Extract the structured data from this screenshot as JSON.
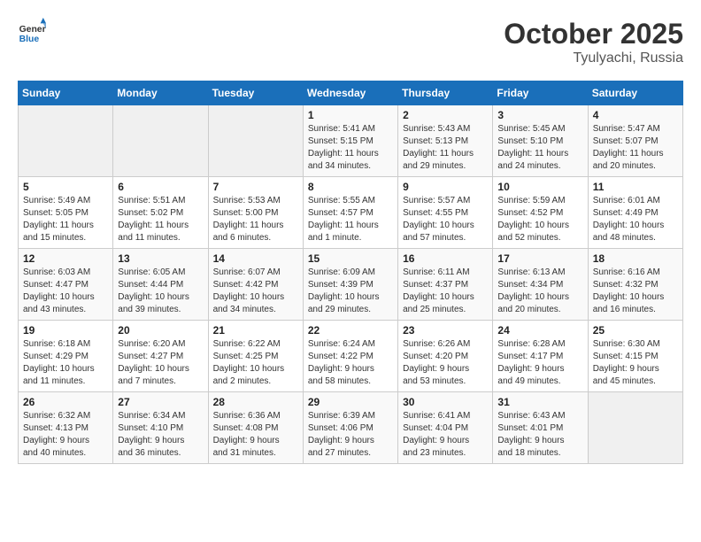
{
  "header": {
    "logo_line1": "General",
    "logo_line2": "Blue",
    "month": "October 2025",
    "location": "Tyulyachi, Russia"
  },
  "days_of_week": [
    "Sunday",
    "Monday",
    "Tuesday",
    "Wednesday",
    "Thursday",
    "Friday",
    "Saturday"
  ],
  "weeks": [
    [
      {
        "day": "",
        "info": ""
      },
      {
        "day": "",
        "info": ""
      },
      {
        "day": "",
        "info": ""
      },
      {
        "day": "1",
        "info": "Sunrise: 5:41 AM\nSunset: 5:15 PM\nDaylight: 11 hours\nand 34 minutes."
      },
      {
        "day": "2",
        "info": "Sunrise: 5:43 AM\nSunset: 5:13 PM\nDaylight: 11 hours\nand 29 minutes."
      },
      {
        "day": "3",
        "info": "Sunrise: 5:45 AM\nSunset: 5:10 PM\nDaylight: 11 hours\nand 24 minutes."
      },
      {
        "day": "4",
        "info": "Sunrise: 5:47 AM\nSunset: 5:07 PM\nDaylight: 11 hours\nand 20 minutes."
      }
    ],
    [
      {
        "day": "5",
        "info": "Sunrise: 5:49 AM\nSunset: 5:05 PM\nDaylight: 11 hours\nand 15 minutes."
      },
      {
        "day": "6",
        "info": "Sunrise: 5:51 AM\nSunset: 5:02 PM\nDaylight: 11 hours\nand 11 minutes."
      },
      {
        "day": "7",
        "info": "Sunrise: 5:53 AM\nSunset: 5:00 PM\nDaylight: 11 hours\nand 6 minutes."
      },
      {
        "day": "8",
        "info": "Sunrise: 5:55 AM\nSunset: 4:57 PM\nDaylight: 11 hours\nand 1 minute."
      },
      {
        "day": "9",
        "info": "Sunrise: 5:57 AM\nSunset: 4:55 PM\nDaylight: 10 hours\nand 57 minutes."
      },
      {
        "day": "10",
        "info": "Sunrise: 5:59 AM\nSunset: 4:52 PM\nDaylight: 10 hours\nand 52 minutes."
      },
      {
        "day": "11",
        "info": "Sunrise: 6:01 AM\nSunset: 4:49 PM\nDaylight: 10 hours\nand 48 minutes."
      }
    ],
    [
      {
        "day": "12",
        "info": "Sunrise: 6:03 AM\nSunset: 4:47 PM\nDaylight: 10 hours\nand 43 minutes."
      },
      {
        "day": "13",
        "info": "Sunrise: 6:05 AM\nSunset: 4:44 PM\nDaylight: 10 hours\nand 39 minutes."
      },
      {
        "day": "14",
        "info": "Sunrise: 6:07 AM\nSunset: 4:42 PM\nDaylight: 10 hours\nand 34 minutes."
      },
      {
        "day": "15",
        "info": "Sunrise: 6:09 AM\nSunset: 4:39 PM\nDaylight: 10 hours\nand 29 minutes."
      },
      {
        "day": "16",
        "info": "Sunrise: 6:11 AM\nSunset: 4:37 PM\nDaylight: 10 hours\nand 25 minutes."
      },
      {
        "day": "17",
        "info": "Sunrise: 6:13 AM\nSunset: 4:34 PM\nDaylight: 10 hours\nand 20 minutes."
      },
      {
        "day": "18",
        "info": "Sunrise: 6:16 AM\nSunset: 4:32 PM\nDaylight: 10 hours\nand 16 minutes."
      }
    ],
    [
      {
        "day": "19",
        "info": "Sunrise: 6:18 AM\nSunset: 4:29 PM\nDaylight: 10 hours\nand 11 minutes."
      },
      {
        "day": "20",
        "info": "Sunrise: 6:20 AM\nSunset: 4:27 PM\nDaylight: 10 hours\nand 7 minutes."
      },
      {
        "day": "21",
        "info": "Sunrise: 6:22 AM\nSunset: 4:25 PM\nDaylight: 10 hours\nand 2 minutes."
      },
      {
        "day": "22",
        "info": "Sunrise: 6:24 AM\nSunset: 4:22 PM\nDaylight: 9 hours\nand 58 minutes."
      },
      {
        "day": "23",
        "info": "Sunrise: 6:26 AM\nSunset: 4:20 PM\nDaylight: 9 hours\nand 53 minutes."
      },
      {
        "day": "24",
        "info": "Sunrise: 6:28 AM\nSunset: 4:17 PM\nDaylight: 9 hours\nand 49 minutes."
      },
      {
        "day": "25",
        "info": "Sunrise: 6:30 AM\nSunset: 4:15 PM\nDaylight: 9 hours\nand 45 minutes."
      }
    ],
    [
      {
        "day": "26",
        "info": "Sunrise: 6:32 AM\nSunset: 4:13 PM\nDaylight: 9 hours\nand 40 minutes."
      },
      {
        "day": "27",
        "info": "Sunrise: 6:34 AM\nSunset: 4:10 PM\nDaylight: 9 hours\nand 36 minutes."
      },
      {
        "day": "28",
        "info": "Sunrise: 6:36 AM\nSunset: 4:08 PM\nDaylight: 9 hours\nand 31 minutes."
      },
      {
        "day": "29",
        "info": "Sunrise: 6:39 AM\nSunset: 4:06 PM\nDaylight: 9 hours\nand 27 minutes."
      },
      {
        "day": "30",
        "info": "Sunrise: 6:41 AM\nSunset: 4:04 PM\nDaylight: 9 hours\nand 23 minutes."
      },
      {
        "day": "31",
        "info": "Sunrise: 6:43 AM\nSunset: 4:01 PM\nDaylight: 9 hours\nand 18 minutes."
      },
      {
        "day": "",
        "info": ""
      }
    ]
  ]
}
